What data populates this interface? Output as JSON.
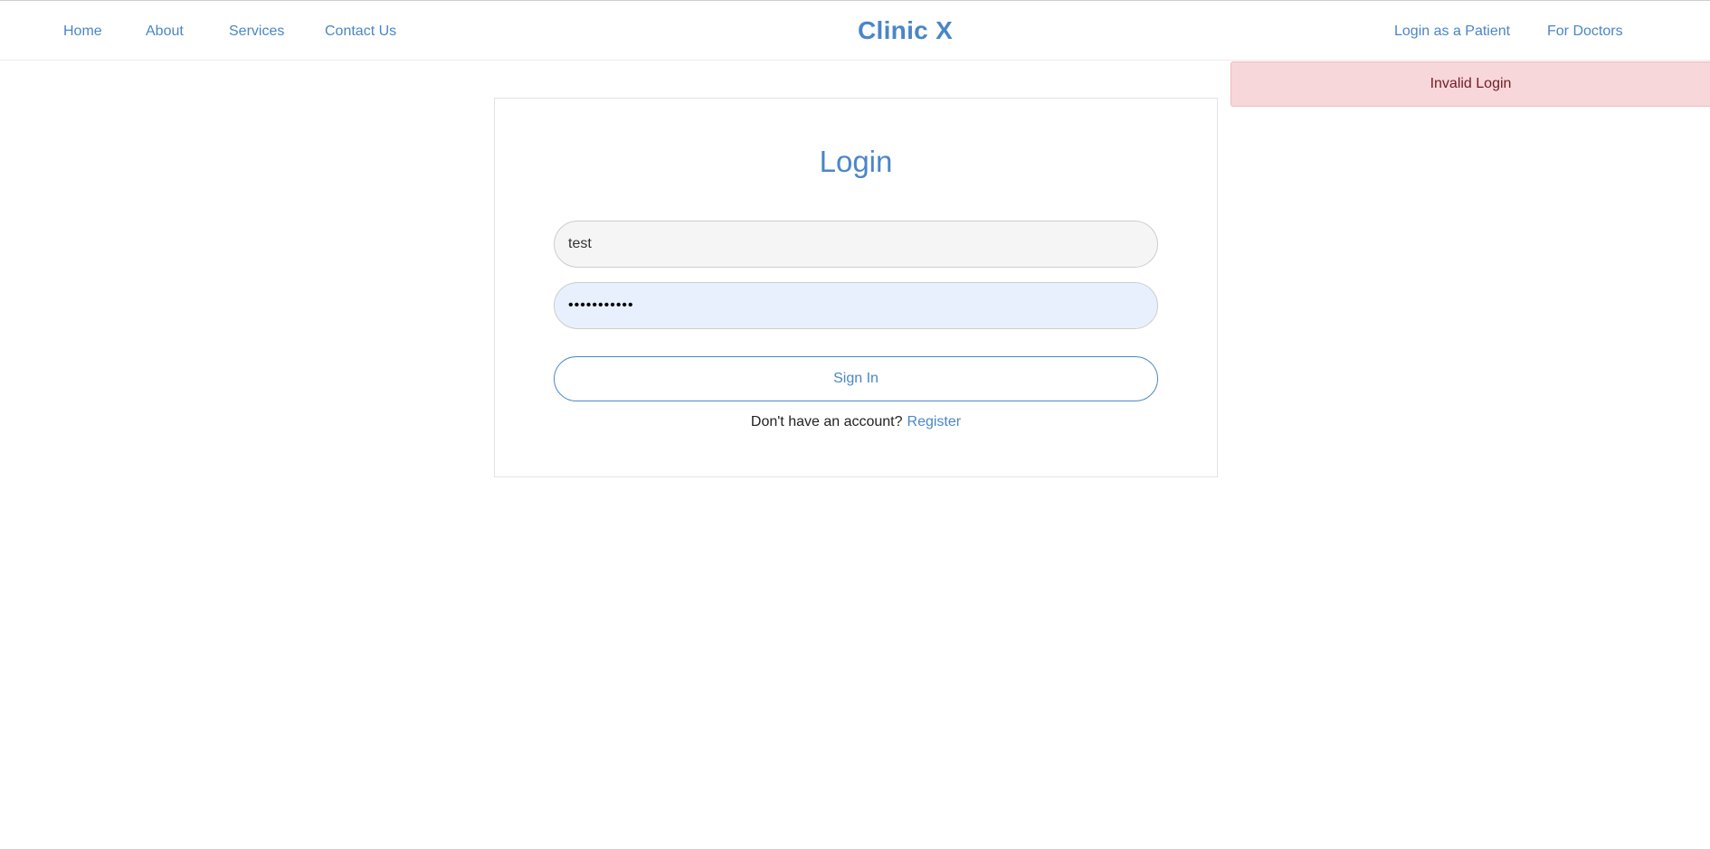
{
  "nav": {
    "left_links": [
      "Home",
      "About",
      "Services",
      "Contact Us"
    ],
    "brand": "Clinic X",
    "right_links": [
      "Login as a Patient",
      "For Doctors"
    ]
  },
  "alert": {
    "message": "Invalid Login"
  },
  "login": {
    "title": "Login",
    "username_value": "test",
    "password_value": "•••••••••••",
    "sign_in_label": "Sign In",
    "register_prompt": "Don't have an account?",
    "register_link": "Register"
  },
  "colors": {
    "accent": "#4a86c8",
    "alert_bg": "#f8d7da",
    "alert_text": "#721c24",
    "password_autofill_bg": "#e8f0fe"
  }
}
